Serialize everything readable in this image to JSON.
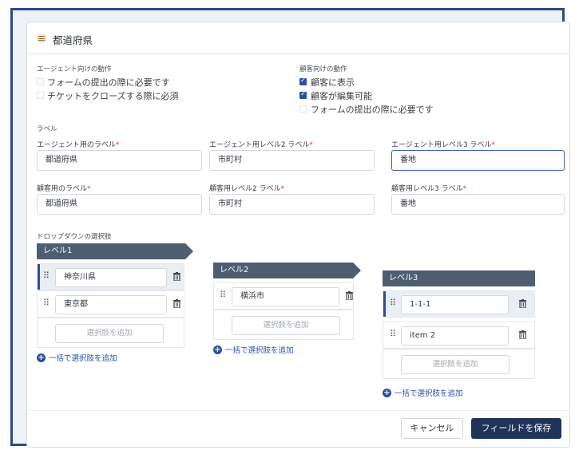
{
  "header": {
    "title": "都道府県"
  },
  "agent_behavior": {
    "label": "エージェント向けの動作",
    "options": [
      {
        "label": "フォームの提出の際に必要です",
        "checked": false
      },
      {
        "label": "チケットをクローズする際に必須",
        "checked": false
      }
    ]
  },
  "customer_behavior": {
    "label": "顧客向けの動作",
    "options": [
      {
        "label": "顧客に表示",
        "checked": true
      },
      {
        "label": "顧客が編集可能",
        "checked": true
      },
      {
        "label": "フォームの提出の際に必要です",
        "checked": false
      }
    ]
  },
  "labels_section": {
    "title": "ラベル"
  },
  "fields": {
    "agent_l1": {
      "label": "エージェント用のラベル",
      "value": "都道府県"
    },
    "agent_l2": {
      "label": "エージェント用レベル2 ラベル",
      "value": "市町村"
    },
    "agent_l3": {
      "label": "エージェント用レベル3 ラベル",
      "value": "番地"
    },
    "cust_l1": {
      "label": "顧客用のラベル",
      "value": "都道府県"
    },
    "cust_l2": {
      "label": "顧客用レベル2 ラベル",
      "value": "市町村"
    },
    "cust_l3": {
      "label": "顧客用レベル3 ラベル",
      "value": "番地"
    },
    "required_mark": "*"
  },
  "dropdown": {
    "title": "ドロップダウンの選択肢",
    "add_placeholder": "選択肢を追加",
    "bulk_add": "一括で選択肢を追加",
    "levels": [
      {
        "name": "レベル1",
        "items": [
          "神奈川県",
          "東京都"
        ]
      },
      {
        "name": "レベル2",
        "items": [
          "横浜市"
        ]
      },
      {
        "name": "レベル3",
        "items": [
          "1-1-1",
          "item 2"
        ]
      }
    ]
  },
  "footer": {
    "cancel": "キャンセル",
    "save": "フィールドを保存"
  },
  "colors": {
    "accent": "#2a4fa3",
    "save_button": "#1f3458",
    "level_tab": "#4f5d71",
    "required": "#d9334a"
  }
}
